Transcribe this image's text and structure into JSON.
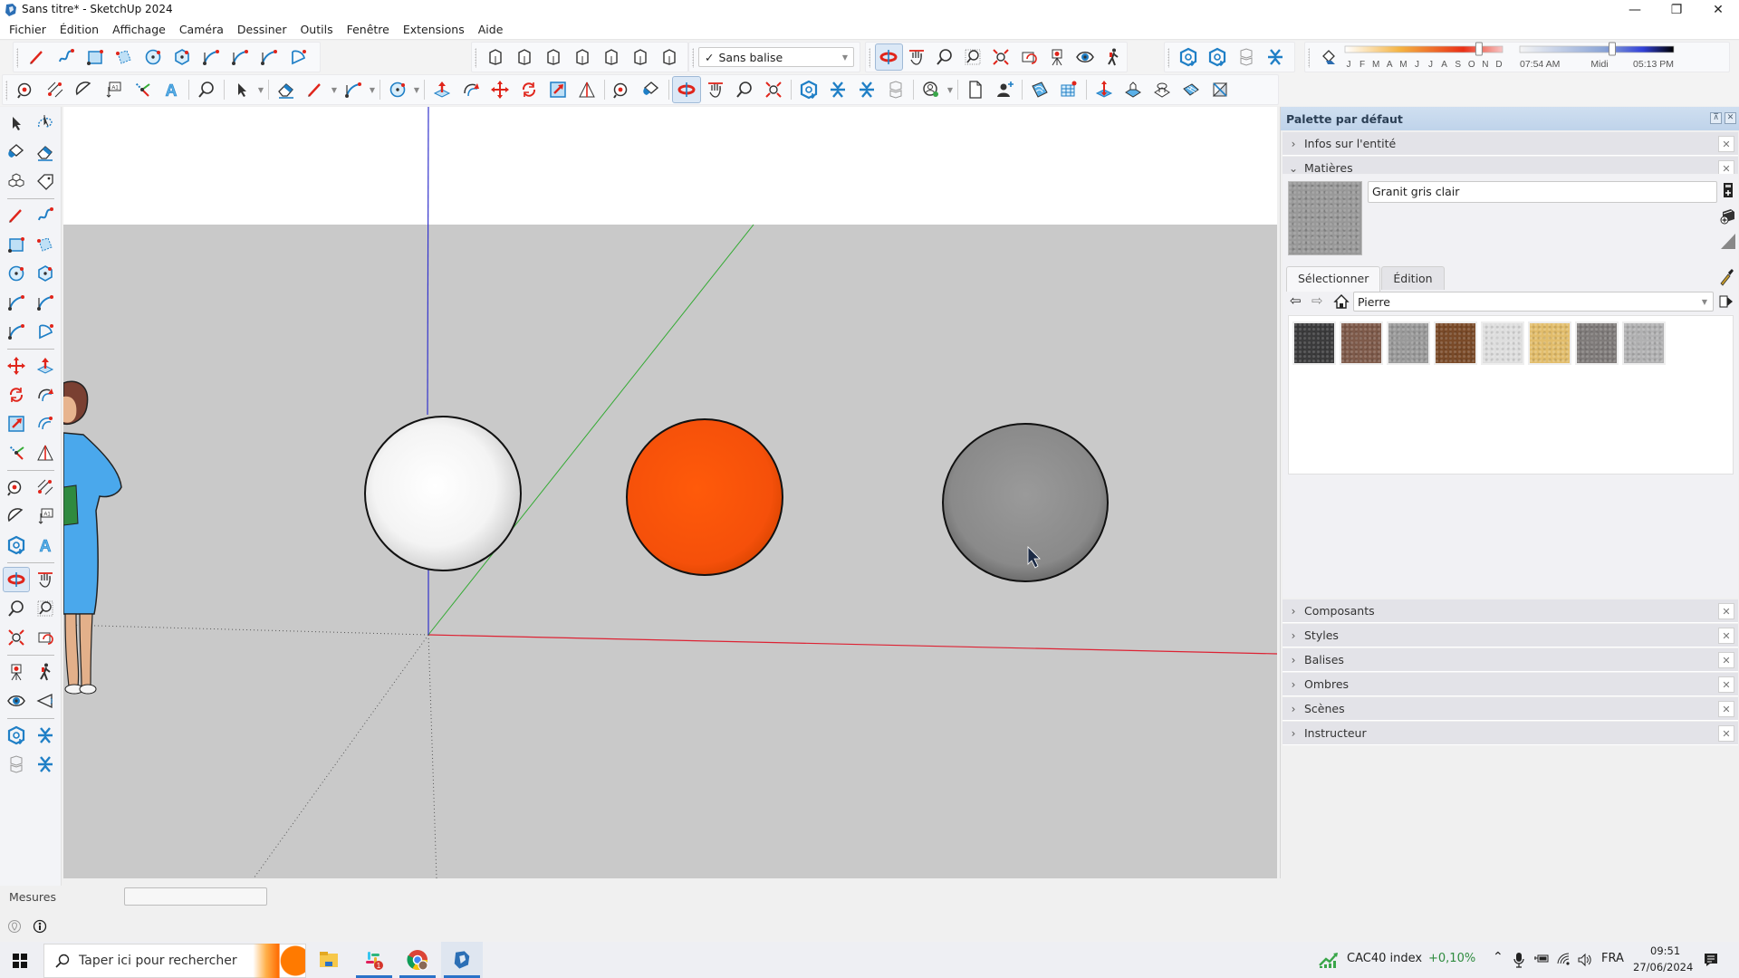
{
  "window": {
    "title": "Sans titre* - SketchUp 2024",
    "controls": {
      "minimize": "—",
      "restore": "❐",
      "close": "✕"
    }
  },
  "menu": [
    "Fichier",
    "Édition",
    "Affichage",
    "Caméra",
    "Dessiner",
    "Outils",
    "Fenêtre",
    "Extensions",
    "Aide"
  ],
  "toolbar": {
    "row1_draw": [
      "line-tool-icon",
      "freehand-tool-icon",
      "rectangle-tool-icon",
      "rotated-rectangle-icon",
      "circle-tool-icon",
      "polygon-tool-icon",
      "arc-tool-icon",
      "two-point-arc-icon",
      "three-point-arc-icon",
      "pie-tool-icon"
    ],
    "row1_views": [
      "iso-view-icon",
      "top-view-icon",
      "front-view-icon",
      "right-view-icon",
      "back-view-icon",
      "left-view-icon",
      "bottom-view-icon"
    ],
    "tag_select": {
      "checked": "✓",
      "value": "Sans balise"
    },
    "row1_camera": [
      "orbit-icon",
      "pan-icon",
      "zoom-icon",
      "zoom-window-icon",
      "zoom-extents-icon",
      "previous-view-icon",
      "position-camera-icon",
      "look-around-icon",
      "walk-icon"
    ],
    "row1_sections": [
      "section-plane-icon",
      "section-plane-fill-icon",
      "section-cuts-icon",
      "section-display-icon"
    ],
    "shadows": {
      "months": [
        "J",
        "F",
        "M",
        "A",
        "M",
        "J",
        "J",
        "A",
        "S",
        "O",
        "N",
        "D"
      ],
      "date_position": 0.85,
      "time_start": "07:54 AM",
      "time_mid": "Midi",
      "time_end": "05:13 PM",
      "time_position": 0.6
    },
    "row2_tools": [
      "tape-measure-icon",
      "dimensions-icon",
      "protractor-icon",
      "text-label-icon",
      "axes-icon",
      "3d-text-icon",
      "zoom-icon",
      "select-icon",
      "eraser-icon",
      "pencil-icon",
      "arc-icon",
      "circle-icon",
      "push-pull-icon",
      "follow-me-icon",
      "move-icon",
      "rotate-icon",
      "scale-icon",
      "flip-icon",
      "tape-icon",
      "paint-bucket-icon",
      "orbit-icon",
      "pan-icon",
      "zoom-icon",
      "zoom-extents-icon",
      "section-plane-icon",
      "section-display-icon",
      "section-cut-icon",
      "section-fill-icon",
      "user-settings-icon",
      "new-file-icon",
      "add-user-icon",
      "sandbox-contours-icon",
      "sandbox-grid-icon",
      "smoove-icon",
      "stamp-icon",
      "drape-icon",
      "add-detail-icon",
      "flip-edge-icon"
    ]
  },
  "left_tools": [
    "select-icon",
    "lasso-icon",
    "paint-bucket-icon",
    "eraser-icon",
    "component-icon",
    "tag-icon",
    "pencil-icon",
    "freehand-icon",
    "rectangle-icon",
    "rotated-rectangle-icon",
    "circle-icon",
    "polygon-icon",
    "arc-icon",
    "two-point-arc-icon",
    "three-point-arc-icon",
    "pie-icon",
    "move-icon",
    "push-pull-icon",
    "rotate-icon",
    "follow-me-icon",
    "scale-icon",
    "offset-icon",
    "axes-icon",
    "flip-icon",
    "tape-measure-icon",
    "dimensions-icon",
    "protractor-icon",
    "text-icon",
    "section-plane-icon",
    "3d-text-icon",
    "orbit-icon",
    "pan-icon",
    "zoom-icon",
    "zoom-window-icon",
    "zoom-extents-icon",
    "previous-icon",
    "position-camera-icon",
    "walk-icon",
    "look-around-icon",
    "sound-icon",
    "section-icon",
    "section-cut-icon",
    "section-fill-icon",
    "section-settings-icon"
  ],
  "viewport": {
    "spheres": [
      {
        "name": "white-sphere",
        "color": "#f2f2f2"
      },
      {
        "name": "orange-sphere",
        "color": "#ff5a0a"
      },
      {
        "name": "gray-sphere",
        "color": "#8a8a8a"
      }
    ],
    "axis_colors": {
      "red": "#d22",
      "green": "#3a3",
      "blue": "#33c"
    }
  },
  "tray": {
    "title": "Palette par défaut",
    "panels_top": [
      {
        "label": "Infos sur l'entité",
        "expanded": false
      },
      {
        "label": "Matières",
        "expanded": true
      }
    ],
    "materials": {
      "current_name": "Granit gris clair",
      "tabs": [
        "Sélectionner",
        "Édition"
      ],
      "active_tab": "Sélectionner",
      "library": "Pierre",
      "swatches": [
        {
          "name": "swatch-dark-stone",
          "color": "#3b3b3c"
        },
        {
          "name": "swatch-brown-granite",
          "color": "#7e5a4a"
        },
        {
          "name": "swatch-gray-granite",
          "color": "#9a9a9a"
        },
        {
          "name": "swatch-brown-stone",
          "color": "#7a4a28"
        },
        {
          "name": "swatch-white-marble",
          "color": "#dedede"
        },
        {
          "name": "swatch-sandstone",
          "color": "#e2bd6b"
        },
        {
          "name": "swatch-mottled-granite",
          "color": "#7f7b7a"
        },
        {
          "name": "swatch-light-granite",
          "color": "#b1b1b2"
        }
      ]
    },
    "panels_bottom": [
      {
        "label": "Composants"
      },
      {
        "label": "Styles"
      },
      {
        "label": "Balises"
      },
      {
        "label": "Ombres"
      },
      {
        "label": "Scènes"
      },
      {
        "label": "Instructeur"
      }
    ]
  },
  "measures": {
    "label": "Mesures",
    "value": ""
  },
  "taskbar": {
    "search_placeholder": "Taper ici pour rechercher",
    "apps": [
      "file-explorer-icon",
      "slack-icon",
      "chrome-icon",
      "sketchup-icon"
    ],
    "slack_badge": "1",
    "stock": {
      "name": "CAC40 index",
      "change": "+0,10%"
    },
    "language": "FRA",
    "time": "09:51",
    "date": "27/06/2024"
  }
}
